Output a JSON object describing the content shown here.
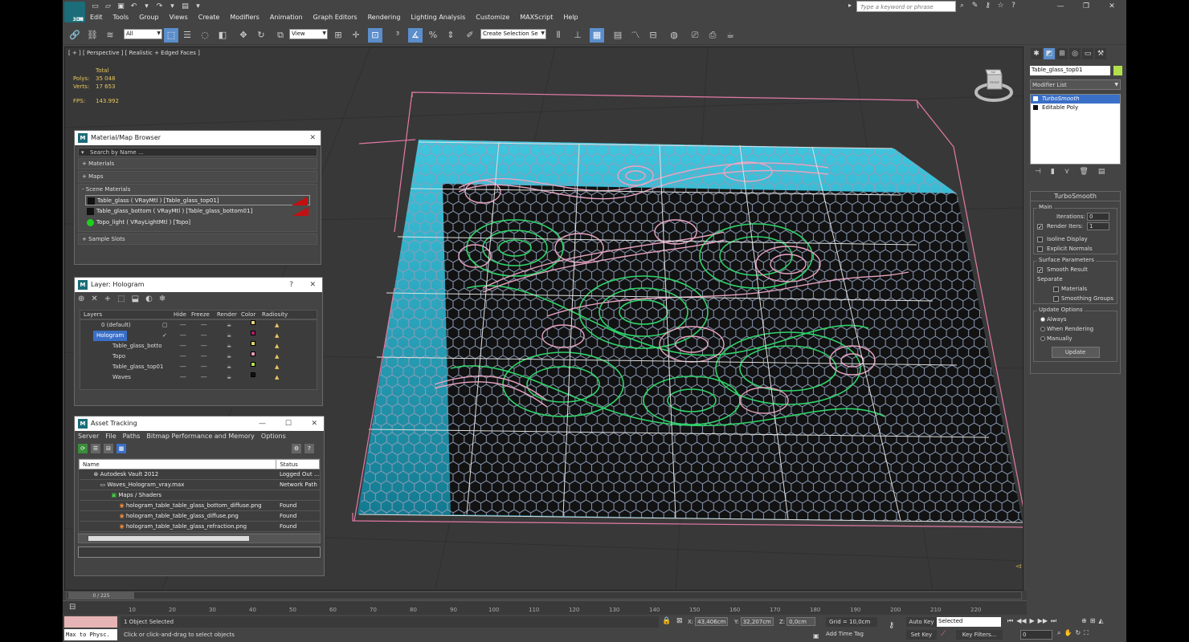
{
  "app": {
    "logo_text": "M",
    "logo_sub": "3DS"
  },
  "menus": [
    "Edit",
    "Tools",
    "Group",
    "Views",
    "Create",
    "Modifiers",
    "Animation",
    "Graph Editors",
    "Rendering",
    "Lighting Analysis",
    "Customize",
    "MAXScript",
    "Help"
  ],
  "search": {
    "placeholder": "Type a keyword or phrase"
  },
  "toolbar": {
    "filter_value": "All",
    "refcoord_value": "View",
    "selection_set_placeholder": "Create Selection Se"
  },
  "viewport": {
    "label": "[ + ] [ Perspective ] [ Realistic + Edged Faces ]",
    "stats": {
      "total_label": "Total",
      "polys_label": "Polys:",
      "polys_value": "35 048",
      "verts_label": "Verts:",
      "verts_value": "17 653",
      "fps_label": "FPS:",
      "fps_value": "143.992"
    },
    "viewcube_top": "TOP",
    "viewcube_front": "FRONT"
  },
  "material_browser": {
    "title": "Material/Map Browser",
    "search_placeholder": "Search by Name ...",
    "sections": [
      "+ Materials",
      "+ Maps"
    ],
    "scene_header": "- Scene Materials",
    "materials": [
      {
        "label": "Table_glass  ( VRayMtl ) [Table_glass_top01]",
        "swatch": "dark"
      },
      {
        "label": "Table_glass_bottom  ( VRayMtl ) [Table_glass_bottom01]",
        "swatch": "dark"
      },
      {
        "label": "Topo_light  ( VRayLightMtl ) [Topo]",
        "swatch": "green"
      }
    ],
    "sample_slots": "+ Sample Slots"
  },
  "layer_panel": {
    "title": "Layer: Hologram",
    "headers": {
      "layers": "Layers",
      "hide": "Hide",
      "freeze": "Freeze",
      "render": "Render",
      "color": "Color",
      "radiosity": "Radiosity"
    },
    "rows": [
      {
        "name": "0 (default)",
        "color": "#e7d27a",
        "indent": 0,
        "selected": false
      },
      {
        "name": "Hologram",
        "color": "#b01e63",
        "indent": 0,
        "selected": true
      },
      {
        "name": "Table_glass_botto",
        "color": "#ddd766",
        "indent": 1,
        "selected": false
      },
      {
        "name": "Topo",
        "color": "#e79ab0",
        "indent": 1,
        "selected": false
      },
      {
        "name": "Table_glass_top01",
        "color": "#b2e04c",
        "indent": 1,
        "selected": false
      },
      {
        "name": "Waves",
        "color": "#111111",
        "indent": 1,
        "selected": false
      }
    ]
  },
  "asset_tracking": {
    "title": "Asset Tracking",
    "menu": [
      "Server",
      "File",
      "Paths",
      "Bitmap Performance and Memory",
      "Options"
    ],
    "col_name": "Name",
    "col_status": "Status",
    "rows": [
      {
        "name": "Autodesk Vault 2012",
        "status": "Logged Out ...",
        "indent": 1
      },
      {
        "name": "Waves_Hologram_vray.max",
        "status": "Network Path",
        "indent": 2
      },
      {
        "name": "Maps / Shaders",
        "status": "",
        "indent": 3
      },
      {
        "name": "hologram_table_table_glass_bottom_diffuse.png",
        "status": "Found",
        "indent": 4
      },
      {
        "name": "hologram_table_table_glass_diffuse.png",
        "status": "Found",
        "indent": 4
      },
      {
        "name": "hologram_table_table_glass_refraction.png",
        "status": "Found",
        "indent": 4
      }
    ]
  },
  "command_panel": {
    "object_name": "Table_glass_top01",
    "object_color": "#b2e04c",
    "modifier_list": "Modifier List",
    "stack": [
      {
        "label": "TurboSmooth",
        "selected": true
      },
      {
        "label": "Editable Poly",
        "selected": false
      }
    ],
    "turbosmooth": {
      "title": "TurboSmooth",
      "main_label": "Main",
      "iterations_label": "Iterations:",
      "iterations_value": "0",
      "render_iters_label": "Render Iters:",
      "render_iters_value": "1",
      "isoline_label": "Isoline Display",
      "explicit_label": "Explicit Normals",
      "surface_label": "Surface Parameters",
      "smooth_result_label": "Smooth Result",
      "separate_label": "Separate",
      "materials_label": "Materials",
      "smoothing_label": "Smoothing Groups",
      "update_label": "Update Options",
      "always_label": "Always",
      "when_rendering_label": "When Rendering",
      "manually_label": "Manually",
      "update_button": "Update"
    }
  },
  "timeline": {
    "frame_label": "0 / 225",
    "ticks": [
      "10",
      "20",
      "30",
      "40",
      "50",
      "60",
      "70",
      "80",
      "90",
      "100",
      "110",
      "120",
      "130",
      "140",
      "150",
      "160",
      "170",
      "180",
      "190",
      "200",
      "210",
      "220"
    ]
  },
  "status": {
    "maxscript": "Max to Physc.",
    "selection": "1 Object Selected",
    "prompt": "Click or click-and-drag to select objects",
    "x_label": "X:",
    "x_value": "43,406cm",
    "y_label": "Y:",
    "y_value": "32,207cm",
    "z_label": "Z:",
    "z_value": "0,0cm",
    "grid": "Grid = 10,0cm",
    "add_time_tag": "Add Time Tag",
    "auto_key": "Auto Key",
    "selected": "Selected",
    "set_key": "Set Key",
    "key_filters": "Key Filters...",
    "frame_value": "0"
  }
}
